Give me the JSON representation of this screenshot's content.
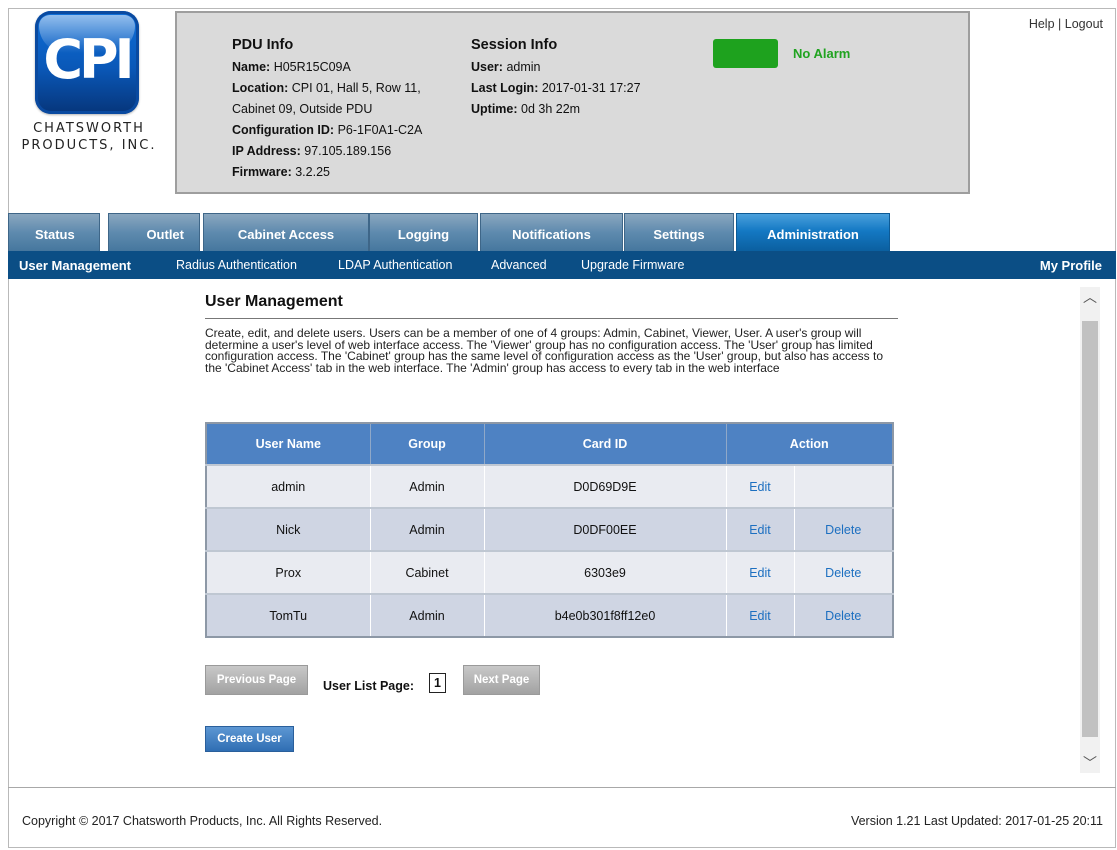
{
  "logo": {
    "mark": "CPI",
    "line1": "CHATSWORTH",
    "line2": "PRODUCTS, INC."
  },
  "pdu_info": {
    "title": "PDU Info",
    "name_label": "Name:",
    "name": "H05R15C09A",
    "location_label": "Location:",
    "location": "CPI 01, Hall 5, Row 11, Cabinet 09, Outside PDU",
    "config_label": "Configuration ID:",
    "config": "P6-1F0A1-C2A",
    "ip_label": "IP Address:",
    "ip": "97.105.189.156",
    "firmware_label": "Firmware:",
    "firmware": "3.2.25"
  },
  "session_info": {
    "title": "Session Info",
    "user_label": "User:",
    "user": "admin",
    "last_login_label": "Last Login:",
    "last_login": "2017-01-31 17:27",
    "uptime_label": "Uptime:",
    "uptime": "0d 3h 22m"
  },
  "alarm": {
    "text": "No Alarm",
    "color": "#1ea21e"
  },
  "header_links": {
    "help": "Help",
    "separator": "|",
    "logout": "Logout"
  },
  "tabs": [
    "Status",
    "Outlet",
    "Cabinet Access",
    "Logging",
    "Notifications",
    "Settings",
    "Administration"
  ],
  "active_tab": "Administration",
  "subnav": {
    "items": [
      "User Management",
      "Radius Authentication",
      "LDAP Authentication",
      "Advanced",
      "Upgrade Firmware"
    ],
    "profile": "My Profile"
  },
  "main": {
    "title": "User Management",
    "description": "Create, edit, and delete users. Users can be a member of one of 4 groups: Admin, Cabinet, Viewer, User. A user's group will determine a user's level of web interface access. The 'Viewer' group has no configuration access. The 'User' group has limited configuration access. The 'Cabinet' group has the same level of configuration access as the 'User' group, but also has access to the 'Cabinet Access' tab in the web interface. The 'Admin' group has access to every tab in the web interface"
  },
  "table": {
    "headers": [
      "User Name",
      "Group",
      "Card ID",
      "Action"
    ],
    "rows": [
      {
        "name": "admin",
        "group": "Admin",
        "card": "D0D69D9E",
        "edit": "Edit",
        "delete": ""
      },
      {
        "name": "Nick",
        "group": "Admin",
        "card": "D0DF00EE",
        "edit": "Edit",
        "delete": "Delete"
      },
      {
        "name": "Prox",
        "group": "Cabinet",
        "card": "6303e9",
        "edit": "Edit",
        "delete": "Delete"
      },
      {
        "name": "TomTu",
        "group": "Admin",
        "card": "b4e0b301f8ff12e0",
        "edit": "Edit",
        "delete": "Delete"
      }
    ]
  },
  "pagination": {
    "prev": "Previous Page",
    "label": "User List Page:",
    "page": "1",
    "next": "Next Page"
  },
  "create_button": "Create User",
  "footer": {
    "copyright": "Copyright © 2017 Chatsworth Products, Inc. All Rights Reserved.",
    "version": "Version 1.21 Last Updated: 2017-01-25 20:11"
  }
}
